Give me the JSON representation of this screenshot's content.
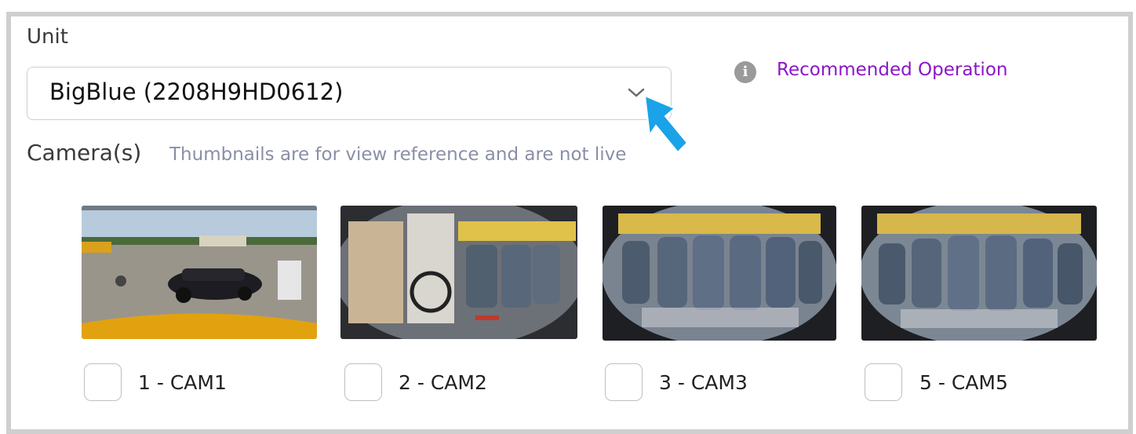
{
  "unit": {
    "label": "Unit",
    "selected": "BigBlue (2208H9HD0612)"
  },
  "recommended_operation": {
    "label": "Recommended Operation"
  },
  "cameras": {
    "title": "Camera(s)",
    "note": "Thumbnails are for view reference and are not live",
    "items": [
      {
        "label": "1 - CAM1"
      },
      {
        "label": "2 - CAM2"
      },
      {
        "label": "3 - CAM3"
      },
      {
        "label": "5 - CAM5"
      }
    ]
  },
  "colors": {
    "accent": "#8a16c9",
    "cursor": "#1aa3e8",
    "border": "#cfcfcf"
  }
}
